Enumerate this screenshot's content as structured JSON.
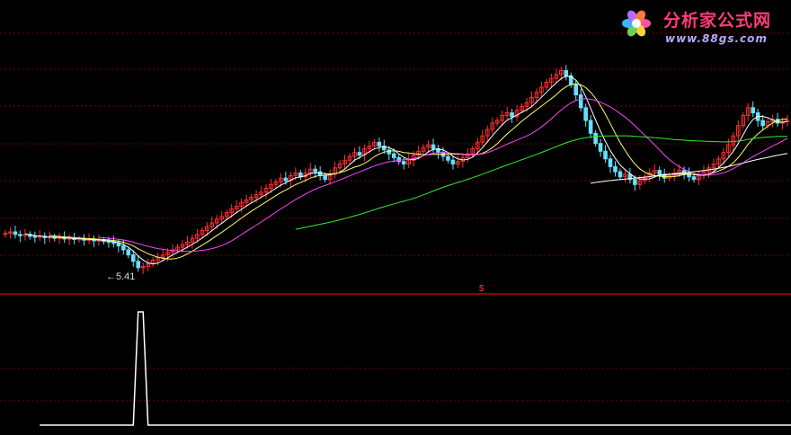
{
  "logo": {
    "name": "分析家公式网",
    "url": "www.88gs.com",
    "icon": "flower-icon"
  },
  "colors": {
    "background": "#000000",
    "grid": "#7a0000",
    "divider": "#c00000",
    "candle_up": "#ff3030",
    "candle_down": "#66e0ff",
    "ma5": "#ffffff",
    "ma10": "#ffff66",
    "ma20": "#ff44ff",
    "ma60": "#33ee33",
    "ma120": "#ffffff",
    "indicator": "#ffffff"
  },
  "chart_data": [
    {
      "type": "candlestick",
      "annotations": [
        {
          "text": "←5.41",
          "at_index": 27
        }
      ],
      "grid": true,
      "close": [
        8.2,
        8.3,
        8.1,
        8.0,
        8.1,
        7.95,
        7.9,
        7.95,
        7.85,
        7.9,
        7.8,
        7.85,
        7.75,
        7.8,
        7.7,
        7.75,
        7.65,
        7.7,
        7.6,
        7.65,
        7.55,
        7.5,
        7.4,
        7.2,
        6.9,
        6.5,
        6.0,
        5.5,
        5.6,
        5.8,
        6.1,
        6.3,
        6.5,
        6.7,
        6.9,
        7.1,
        7.3,
        7.5,
        7.8,
        8.1,
        8.4,
        8.7,
        9.0,
        9.3,
        9.5,
        9.8,
        10.1,
        10.3,
        10.6,
        10.8,
        11.0,
        11.2,
        11.4,
        11.7,
        12.0,
        12.2,
        12.5,
        12.3,
        12.7,
        12.9,
        12.6,
        12.9,
        13.2,
        13.0,
        12.7,
        12.4,
        12.8,
        13.3,
        13.6,
        13.9,
        14.2,
        14.5,
        14.3,
        14.8,
        15.0,
        15.3,
        15.0,
        14.7,
        14.4,
        14.1,
        13.8,
        13.6,
        13.9,
        14.3,
        14.6,
        14.9,
        15.1,
        14.8,
        14.5,
        14.2,
        13.9,
        13.6,
        13.8,
        14.1,
        14.4,
        14.8,
        15.3,
        15.8,
        16.3,
        16.8,
        17.0,
        17.4,
        17.6,
        17.3,
        17.8,
        18.1,
        18.4,
        18.8,
        19.2,
        19.6,
        20.0,
        20.3,
        20.6,
        20.9,
        20.5,
        19.8,
        19.0,
        18.0,
        17.0,
        16.0,
        15.2,
        14.6,
        14.0,
        13.4,
        13.0,
        12.6,
        12.8,
        12.4,
        12.0,
        12.3,
        12.6,
        12.9,
        13.1,
        12.8,
        12.5,
        12.7,
        12.9,
        13.1,
        12.9,
        12.6,
        12.4,
        12.7,
        13.0,
        13.3,
        13.6,
        14.0,
        14.5,
        15.1,
        15.8,
        16.6,
        17.4,
        18.0,
        17.6,
        17.0,
        16.6,
        16.9,
        17.1,
        16.8,
        16.9,
        17.0
      ],
      "open": [
        8.1,
        8.2,
        8.3,
        8.1,
        8.0,
        8.1,
        7.95,
        7.9,
        7.95,
        7.85,
        7.9,
        7.8,
        7.85,
        7.75,
        7.8,
        7.7,
        7.75,
        7.65,
        7.7,
        7.6,
        7.65,
        7.55,
        7.5,
        7.4,
        7.2,
        6.9,
        6.5,
        6.0,
        5.5,
        5.6,
        5.8,
        6.1,
        6.3,
        6.5,
        6.7,
        6.9,
        7.1,
        7.3,
        7.5,
        7.8,
        8.1,
        8.4,
        8.7,
        9.0,
        9.3,
        9.5,
        9.8,
        10.1,
        10.3,
        10.6,
        10.8,
        11.0,
        11.2,
        11.4,
        11.7,
        12.0,
        12.2,
        12.5,
        12.3,
        12.7,
        12.9,
        12.6,
        12.9,
        13.2,
        13.0,
        12.7,
        12.4,
        12.8,
        13.3,
        13.6,
        13.9,
        14.2,
        14.5,
        14.3,
        14.8,
        15.0,
        15.3,
        15.0,
        14.7,
        14.4,
        14.1,
        13.8,
        13.6,
        13.9,
        14.3,
        14.6,
        14.9,
        15.1,
        14.8,
        14.5,
        14.2,
        13.9,
        13.6,
        13.8,
        14.1,
        14.4,
        14.8,
        15.3,
        15.8,
        16.3,
        16.8,
        17.0,
        17.4,
        17.6,
        17.3,
        17.8,
        18.1,
        18.4,
        18.8,
        19.2,
        19.6,
        20.0,
        20.3,
        20.6,
        20.9,
        20.5,
        19.8,
        19.0,
        18.0,
        17.0,
        16.0,
        15.2,
        14.6,
        14.0,
        13.4,
        13.0,
        12.6,
        12.8,
        12.4,
        12.0,
        12.3,
        12.6,
        12.9,
        13.1,
        12.8,
        12.5,
        12.7,
        12.9,
        13.1,
        12.9,
        12.6,
        12.4,
        12.7,
        13.0,
        13.3,
        13.6,
        14.0,
        14.5,
        15.1,
        15.8,
        16.6,
        17.4,
        18.0,
        17.6,
        17.0,
        16.6,
        16.9,
        17.1,
        16.8,
        16.9
      ],
      "moving_averages": [
        "MA5",
        "MA10",
        "MA20",
        "MA60",
        "MA120"
      ]
    },
    {
      "type": "line",
      "values": [
        0,
        0,
        0,
        0,
        0,
        0,
        0,
        0,
        0,
        0,
        0,
        0,
        0,
        0,
        0,
        0,
        0,
        0,
        0,
        0,
        0,
        0,
        0,
        0,
        0,
        0,
        0,
        1,
        1,
        0,
        0,
        0,
        0,
        0,
        0,
        0,
        0,
        0,
        0,
        0,
        0,
        0,
        0,
        0,
        0,
        0,
        0,
        0,
        0,
        0,
        0,
        0,
        0,
        0,
        0,
        0,
        0,
        0,
        0,
        0,
        0,
        0,
        0,
        0,
        0,
        0,
        0,
        0,
        0,
        0,
        0,
        0,
        0,
        0,
        0,
        0,
        0,
        0,
        0,
        0,
        0,
        0,
        0,
        0,
        0,
        0,
        0,
        0,
        0,
        0,
        0,
        0,
        0,
        0,
        0,
        0,
        0,
        0,
        0,
        0,
        0,
        0,
        0,
        0,
        0,
        0,
        0,
        0,
        0,
        0,
        0,
        0,
        0,
        0,
        0,
        0,
        0,
        0,
        0,
        0,
        0,
        0,
        0,
        0,
        0,
        0,
        0,
        0,
        0,
        0,
        0,
        0,
        0,
        0,
        0,
        0,
        0,
        0,
        0,
        0,
        0,
        0,
        0,
        0,
        0,
        0,
        0,
        0,
        0,
        0,
        0,
        0,
        0,
        0,
        0,
        0,
        0,
        0,
        0,
        0,
        0,
        0,
        0,
        0,
        0,
        0,
        0,
        0,
        0,
        0,
        0
      ],
      "ylim": [
        0,
        1
      ]
    }
  ],
  "divider_marker": "$"
}
